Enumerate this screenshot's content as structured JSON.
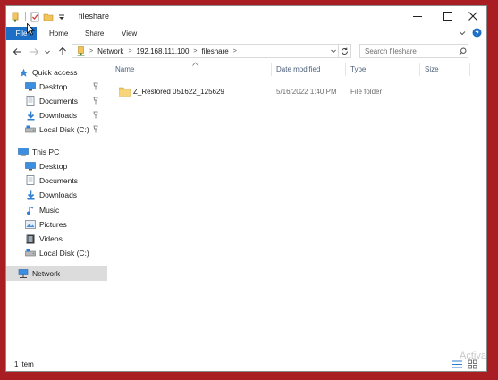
{
  "window": {
    "title": "fileshare"
  },
  "ribbon": {
    "tabs": [
      "File",
      "Home",
      "Share",
      "View"
    ]
  },
  "address": {
    "crumbs": [
      "Network",
      "192.168.111.100",
      "fileshare"
    ]
  },
  "search": {
    "placeholder": "Search fileshare"
  },
  "navpane": {
    "quick_access": "Quick access",
    "quick_items": [
      "Desktop",
      "Documents",
      "Downloads",
      "Local Disk (C:)"
    ],
    "this_pc": "This PC",
    "pc_items": [
      "Desktop",
      "Documents",
      "Downloads",
      "Music",
      "Pictures",
      "Videos",
      "Local Disk (C:)"
    ],
    "network": "Network"
  },
  "columns": {
    "name": "Name",
    "date": "Date modified",
    "type": "Type",
    "size": "Size"
  },
  "files": [
    {
      "name": "Z_Restored 051622_125629",
      "date": "5/16/2022 1:40 PM",
      "type": "File folder",
      "size": "",
      "icon": "folder-icon"
    }
  ],
  "status": {
    "count": "1 item"
  },
  "watermark": {
    "text": "Activa"
  },
  "colors": {
    "desktop": "#a91e22",
    "file_tab": "#1c6fc4",
    "folder": "#f2c45a",
    "selected": "#dcdcdc"
  }
}
